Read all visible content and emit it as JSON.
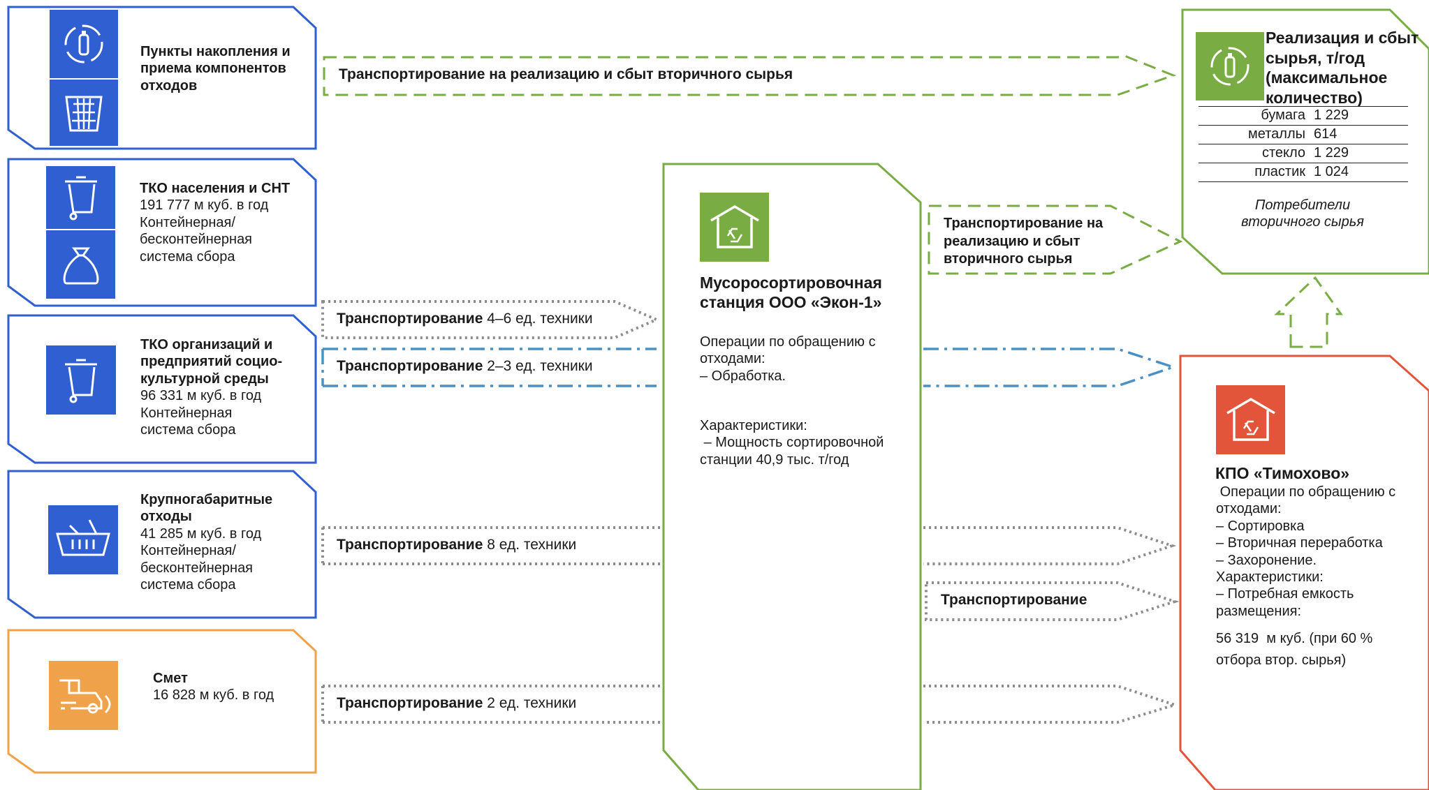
{
  "colors": {
    "blue": "#2f5fd0",
    "orange": "#f0a24a",
    "green": "#7aac44",
    "red": "#e2553a",
    "dark_dotted": "#8c8c8c",
    "blue_dashdot": "#4a90c4"
  },
  "sources": [
    {
      "title": "Пункты накопления и приема компонентов отходов",
      "volume": "",
      "system": "",
      "icons": [
        "recycle-bottle-icon",
        "wastebasket-icon"
      ]
    },
    {
      "title": "ТКО населения и СНТ",
      "volume": "191 777 м куб. в год",
      "system": "Контейнерная/ бесконтейнерная система сбора",
      "icons": [
        "bin-icon",
        "garbage-bag-icon"
      ]
    },
    {
      "title": "ТКО организаций и предприятий социо-культурной среды",
      "volume": "96 331 м куб. в год",
      "system": "Контейнерная система сбора",
      "icons": [
        "bin-icon"
      ]
    },
    {
      "title": "Крупногабаритные отходы",
      "volume": "41 285 м куб. в год",
      "system": "Контейнерная/ бесконтейнерная система сбора",
      "icons": [
        "basket-icon"
      ]
    },
    {
      "title": "Смет",
      "volume": "16 828 м куб. в год",
      "system": "",
      "icons": [
        "sweeper-truck-icon"
      ]
    }
  ],
  "arrows": {
    "top": {
      "lead": "Транспортирование на реализацию и сбыт вторичного сырья"
    },
    "a1": {
      "lead": "Транспортирование",
      "rest": " 4–6 ед. техники"
    },
    "a2": {
      "lead": "Транспортирование",
      "rest": " 2–3 ед. техники"
    },
    "a3": {
      "lead": "Транспортирование",
      "rest": " 8 ед. техники"
    },
    "a4": {
      "lead": "Транспортирование",
      "rest": " 2 ед. техники"
    },
    "mid_green": {
      "line1": "Транспортирование на",
      "line2": "реализацию и сбыт",
      "line3": "вторичного сырья"
    },
    "mid_dotted": {
      "lead": "Транспортирование"
    }
  },
  "station": {
    "name": "Мусоросортировочная станция ООО «Экон-1»",
    "ops_title": "Операции по обращению с отходами:",
    "ops_item": "– Обработка.",
    "char_title": "Характеристики:",
    "char_item": " – Мощность сортировочной станции 40,9 тыс. т/год"
  },
  "sales": {
    "title": "Реализация и сбыт сырья, т/год (максимальное количество)",
    "rows": [
      {
        "name": "бумага",
        "value": "1 229"
      },
      {
        "name": "металлы",
        "value": "614"
      },
      {
        "name": "стекло",
        "value": "1 229"
      },
      {
        "name": "пластик",
        "value": "1 024"
      }
    ],
    "consumers": "Потребители вторичного сырья"
  },
  "kpo": {
    "name": "КПО «Тимохово»",
    "ops_title": " Операции по обращению с отходами:",
    "ops1": "– Сортировка",
    "ops2": "– Вторичная переработка",
    "ops3": "– Захоронение.",
    "char_title": "Характеристики:",
    "char1": "– Потребная емкость размещения:",
    "capacity": "56 319  м куб. (при 60 % отбора втор. сырья)"
  }
}
